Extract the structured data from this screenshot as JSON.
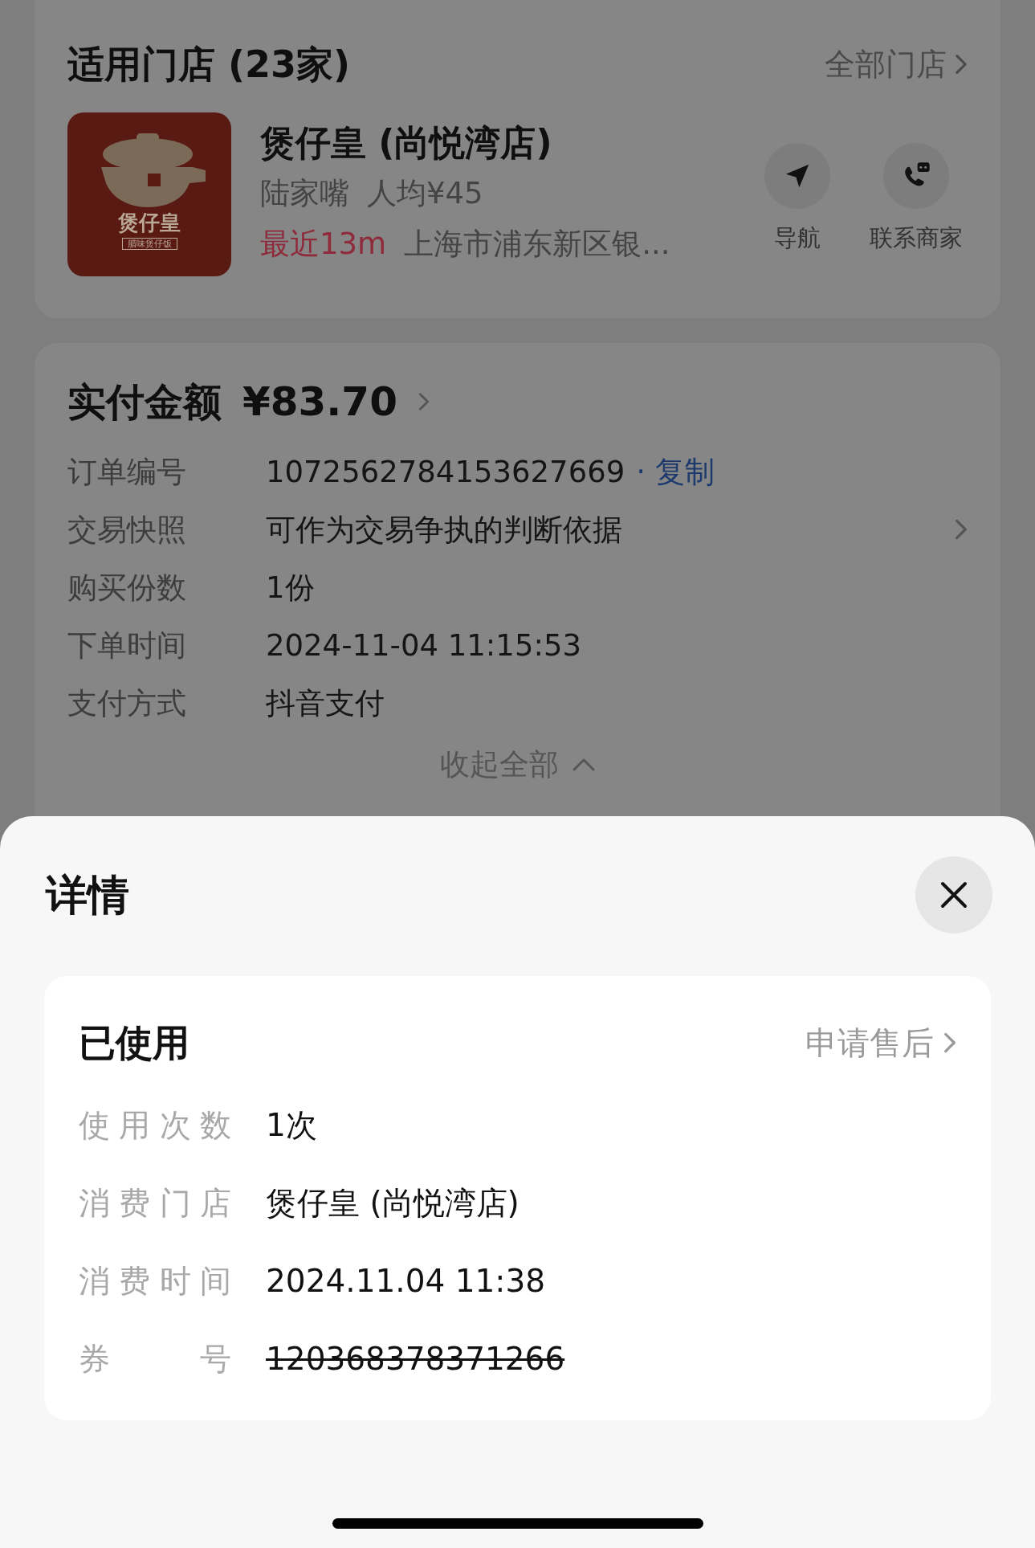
{
  "stores_card": {
    "title": "适用门店 (23家)",
    "all_link": "全部门店",
    "store": {
      "logo": {
        "name": "煲仔皇",
        "tagline": "腊味煲仔饭"
      },
      "name": "煲仔皇 (尚悦湾店)",
      "area": "陆家嘴",
      "avg_price": "人均¥45",
      "distance": "最近13m",
      "address": "上海市浦东新区银..."
    },
    "actions": [
      {
        "kind": "navigate",
        "label": "导航"
      },
      {
        "kind": "contact",
        "label": "联系商家"
      }
    ]
  },
  "payment_card": {
    "title": "实付金额",
    "amount": "¥83.70",
    "rows": [
      {
        "label": "订单编号",
        "value": "1072562784153627669",
        "action": "· 复制"
      },
      {
        "label": "交易快照",
        "value": "可作为交易争执的判断依据",
        "chevron": true
      },
      {
        "label": "购买份数",
        "value": "1份"
      },
      {
        "label": "下单时间",
        "value": "2024-11-04 11:15:53"
      },
      {
        "label": "支付方式",
        "value": "抖音支付"
      }
    ],
    "collapse": "收起全部"
  },
  "sheet": {
    "title": "详情",
    "status": "已使用",
    "after_sale": "申请售后",
    "rows": [
      {
        "label": "使用次数",
        "value": "1次",
        "struck": false
      },
      {
        "label": "消费门店",
        "value": "煲仔皇 (尚悦湾店)",
        "struck": false
      },
      {
        "label": "消费时间",
        "value": "2024.11.04 11:38",
        "struck": false
      },
      {
        "label": "券号",
        "value": "120368378371266",
        "struck": true
      }
    ]
  }
}
